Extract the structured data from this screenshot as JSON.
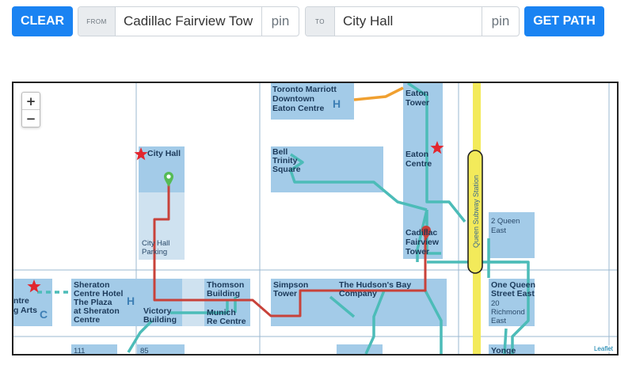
{
  "toolbar": {
    "clear_label": "CLEAR",
    "from_label": "FROM",
    "from_value": "Cadillac Fairview Towe",
    "from_pin": "pin",
    "to_label": "TO",
    "to_value": "City Hall",
    "to_pin": "pin",
    "get_path_label": "GET PATH"
  },
  "map": {
    "zoom_in": "+",
    "zoom_out": "−",
    "attribution": "Leaflet",
    "subway_station": "Queen Subway Station",
    "buildings": {
      "toronto_marriott": [
        "Toronto Marriott",
        "Downtown",
        "Eaton Centre"
      ],
      "eaton_tower": [
        "Eaton",
        "Tower"
      ],
      "eaton_centre": [
        "Eaton",
        "Centre"
      ],
      "city_hall": [
        "City Hall"
      ],
      "city_hall_parking": [
        "City Hall",
        "Parking"
      ],
      "bell_trinity": [
        "Bell",
        "Trinity",
        "Square"
      ],
      "cadillac_fairview": [
        "Cadillac",
        "Fairview",
        "Tower"
      ],
      "two_queen_east": [
        "2 Queen",
        "East"
      ],
      "arts_fragment": [
        "ntre",
        "g Arts"
      ],
      "sheraton": [
        "Sheraton",
        "Centre Hotel",
        "The Plaza",
        "at Sheraton",
        "Centre"
      ],
      "victory": [
        "Victory",
        "Building"
      ],
      "thomson": [
        "Thomson",
        "Building"
      ],
      "munich_re": [
        "Munich",
        "Re Centre"
      ],
      "simpson": [
        "Simpson",
        "Tower"
      ],
      "hudsons_bay": [
        "The Hudson's Bay",
        "Company"
      ],
      "one_queen_east": [
        "One Queen",
        "Street East"
      ],
      "twenty_richmond": [
        "20",
        "Richmond",
        "East"
      ],
      "one_eleven": [
        "111"
      ],
      "eighty_five": [
        "85"
      ],
      "yonge": [
        "Yonge"
      ]
    },
    "hotel_marker": "H",
    "c_marker": "C"
  },
  "colors": {
    "primary_button": "#1a83f2",
    "building_fill": "#a3cbe8",
    "building_light": "#cfe2f0",
    "pedestrian_path": "#4cbcb8",
    "route_path": "#c8423a",
    "orange_path": "#f0a030",
    "subway_fill": "#f3ea5a",
    "star": "#e2262e",
    "origin_marker": "#55bb55"
  }
}
